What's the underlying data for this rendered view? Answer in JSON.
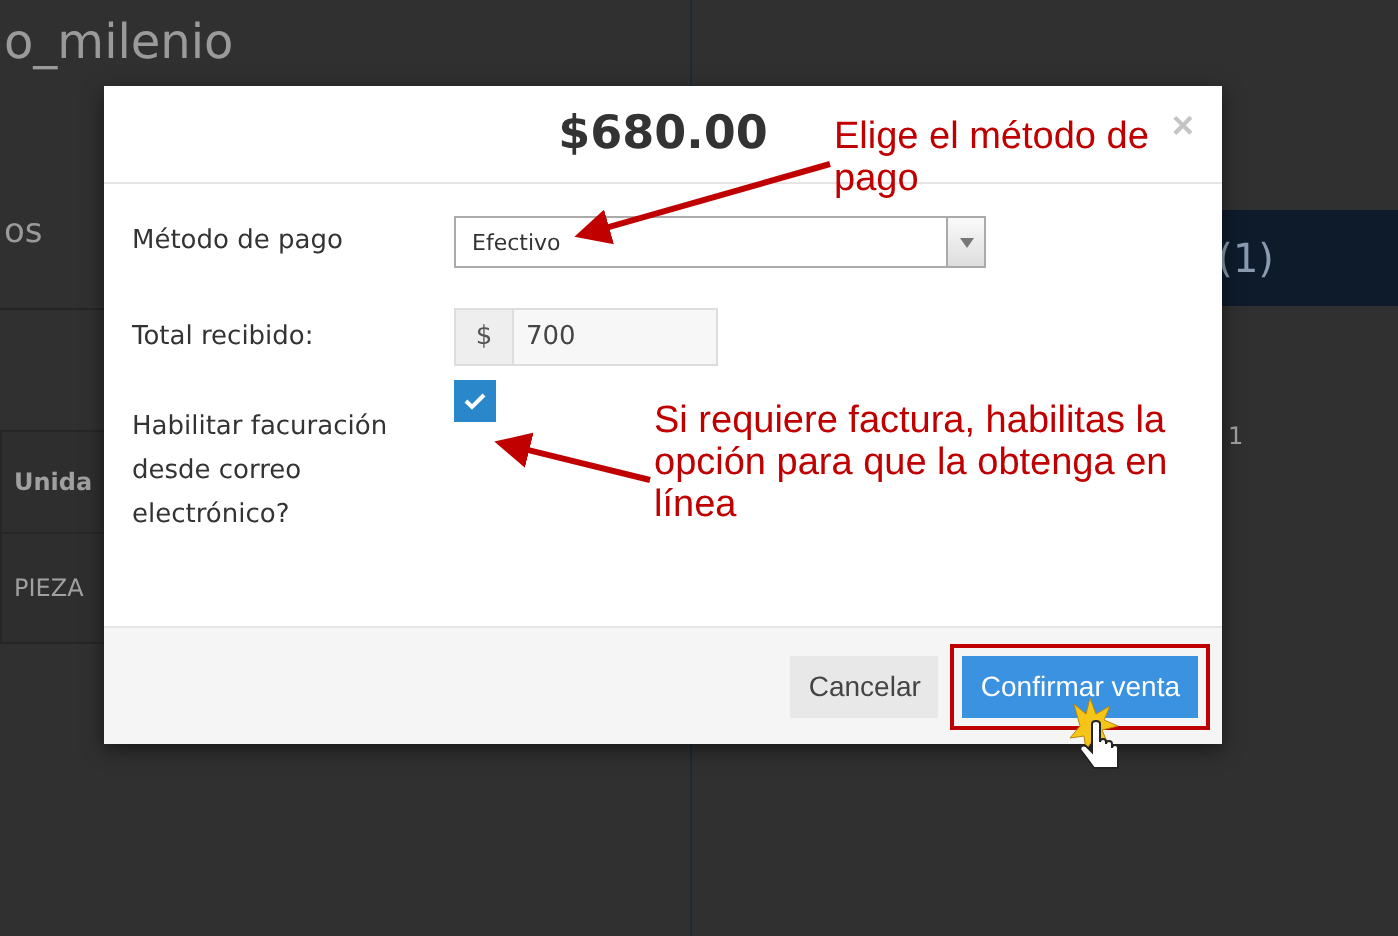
{
  "background_page": {
    "title": "o_milenio",
    "tab_label": "os",
    "cart_count": "(1)",
    "right_value": "1",
    "table": {
      "column_header": "Unida",
      "cell": "PIEZA"
    }
  },
  "modal": {
    "title": "$680.00",
    "close": "×",
    "fields": [
      {
        "kind": "select",
        "label": "Método de pago",
        "value": "Efectivo"
      },
      {
        "kind": "money",
        "label": "Total recibido:",
        "prefix": "$",
        "value": "700"
      },
      {
        "kind": "checkbox",
        "label": "Habilitar facuración desde correo electrónico?",
        "checked": true
      }
    ],
    "buttons": [
      {
        "label": "Cancelar",
        "kind": "secondary",
        "highlighted": false
      },
      {
        "label": "Confirmar venta",
        "kind": "primary",
        "highlighted": true
      }
    ]
  },
  "annotations": [
    {
      "text": "Elige el método de pago"
    },
    {
      "text": "Si requiere factura, habilitas la opción para que la obtenga en línea"
    }
  ]
}
